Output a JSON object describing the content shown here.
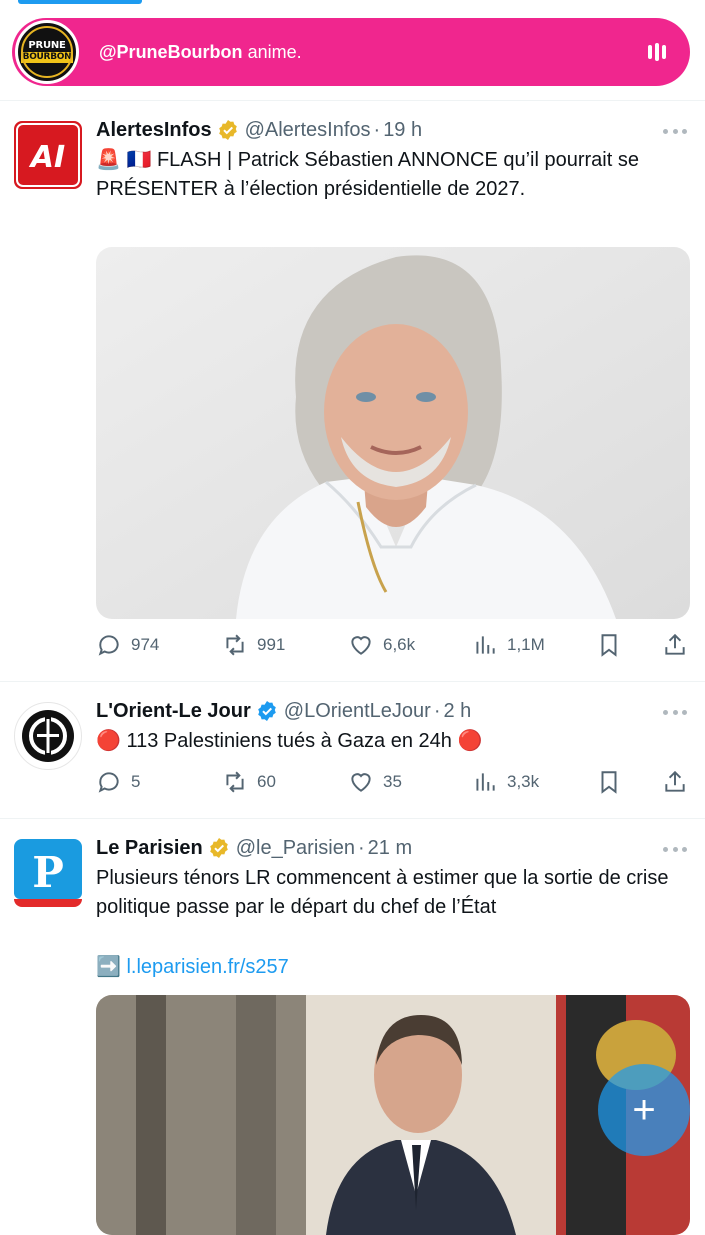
{
  "colors": {
    "accent": "#1d9bf0",
    "live_pink": "#f0268e",
    "verified_gold": "#e8b829",
    "verified_blue": "#1d9bf0",
    "muted": "#536471"
  },
  "live": {
    "host": "@PruneBourbon",
    "status": "anime.",
    "avatar_line1": "PRUNE",
    "avatar_line2": "BOURBON"
  },
  "tweets": [
    {
      "name": "AlertesInfos",
      "verified": "gold",
      "handle": "@AlertesInfos",
      "sep": "·",
      "time": "19 h",
      "avatar_text": "AI",
      "text_emoji": "🚨 🇫🇷",
      "text": "FLASH | Patrick Sébastien ANNONCE qu’il pourrait se PRÉSENTER à l’élection présidentielle de 2027.",
      "media": "portrait-photo",
      "replies": "974",
      "reposts": "991",
      "likes": "6,6k",
      "views": "1,1M"
    },
    {
      "name": "L'Orient-Le Jour",
      "verified": "blue",
      "handle": "@LOrientLeJour",
      "sep": "·",
      "time": "2 h",
      "text_prefix": "🔴",
      "text": "113 Palestiniens tués à Gaza en 24h",
      "text_suffix": "🔴",
      "replies": "5",
      "reposts": "60",
      "likes": "35",
      "views": "3,3k"
    },
    {
      "name": "Le Parisien",
      "verified": "gold",
      "handle": "@le_Parisien",
      "sep": "·",
      "time": "21 m",
      "avatar_text": "P",
      "text": "Plusieurs ténors LR commencent à estimer que la sortie de crise politique passe par le départ du chef de l’État",
      "link_prefix": "➡️",
      "link": "l.leparisien.fr/s257",
      "media": "palace-photo"
    }
  ],
  "fab": {
    "icon": "+"
  }
}
